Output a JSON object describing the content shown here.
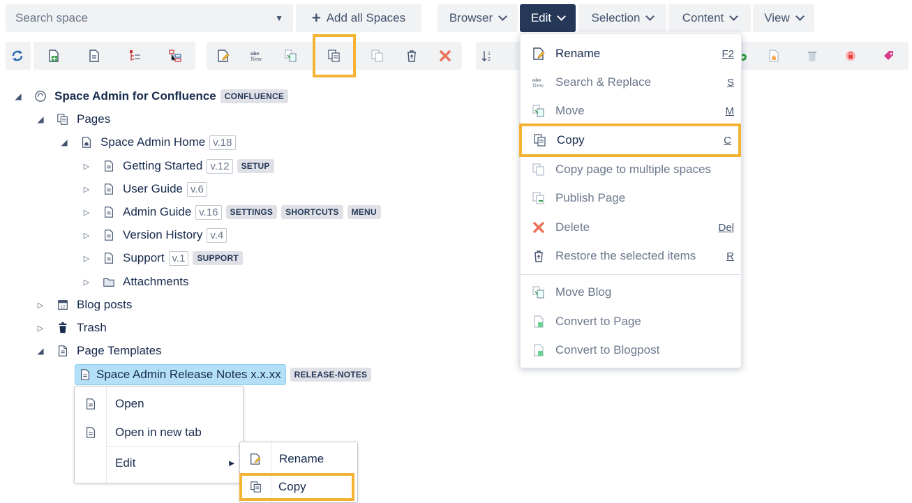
{
  "search": {
    "placeholder": "Search space"
  },
  "topbar": {
    "add_all_spaces": "Add all Spaces",
    "browser": "Browser",
    "edit": "Edit",
    "selection": "Selection",
    "content": "Content",
    "view": "View"
  },
  "tree": {
    "root": {
      "label": "Space Admin for Confluence",
      "badge": "CONFLUENCE"
    },
    "pages": "Pages",
    "home": {
      "label": "Space Admin Home",
      "version": "v.18"
    },
    "children": [
      {
        "label": "Getting Started",
        "version": "v.12",
        "badges": [
          "SETUP"
        ]
      },
      {
        "label": "User Guide",
        "version": "v.6",
        "badges": []
      },
      {
        "label": "Admin Guide",
        "version": "v.16",
        "badges": [
          "SETTINGS",
          "SHORTCUTS",
          "MENU"
        ]
      },
      {
        "label": "Version History",
        "version": "v.4",
        "badges": []
      },
      {
        "label": "Support",
        "version": "v.1",
        "badges": [
          "SUPPORT"
        ]
      }
    ],
    "attachments": "Attachments",
    "blog_posts": "Blog posts",
    "trash": "Trash",
    "page_templates": "Page Templates",
    "template": {
      "label": "Space Admin Release Notes x.x.xx",
      "badge": "RELEASE-NOTES"
    }
  },
  "edit_menu": {
    "rename": {
      "label": "Rename",
      "shortcut": "F2"
    },
    "search_replace": {
      "label": "Search & Replace",
      "shortcut": "S"
    },
    "move": {
      "label": "Move",
      "shortcut": "M"
    },
    "copy": {
      "label": "Copy",
      "shortcut": "C"
    },
    "copy_multi": {
      "label": "Copy page to multiple spaces"
    },
    "publish": {
      "label": "Publish Page"
    },
    "delete": {
      "label": "Delete",
      "shortcut": "Del"
    },
    "restore": {
      "label": "Restore the selected items",
      "shortcut": "R"
    },
    "move_blog": {
      "label": "Move Blog"
    },
    "convert_page": {
      "label": "Convert to Page"
    },
    "convert_blog": {
      "label": "Convert to Blogpost"
    }
  },
  "context_menu": {
    "open": "Open",
    "open_new_tab": "Open in new tab",
    "edit": "Edit"
  },
  "submenu": {
    "rename": "Rename",
    "copy": "Copy"
  },
  "colors": {
    "accent": "#253858",
    "highlight": "#f5b335",
    "selected": "#b3e0f7"
  }
}
